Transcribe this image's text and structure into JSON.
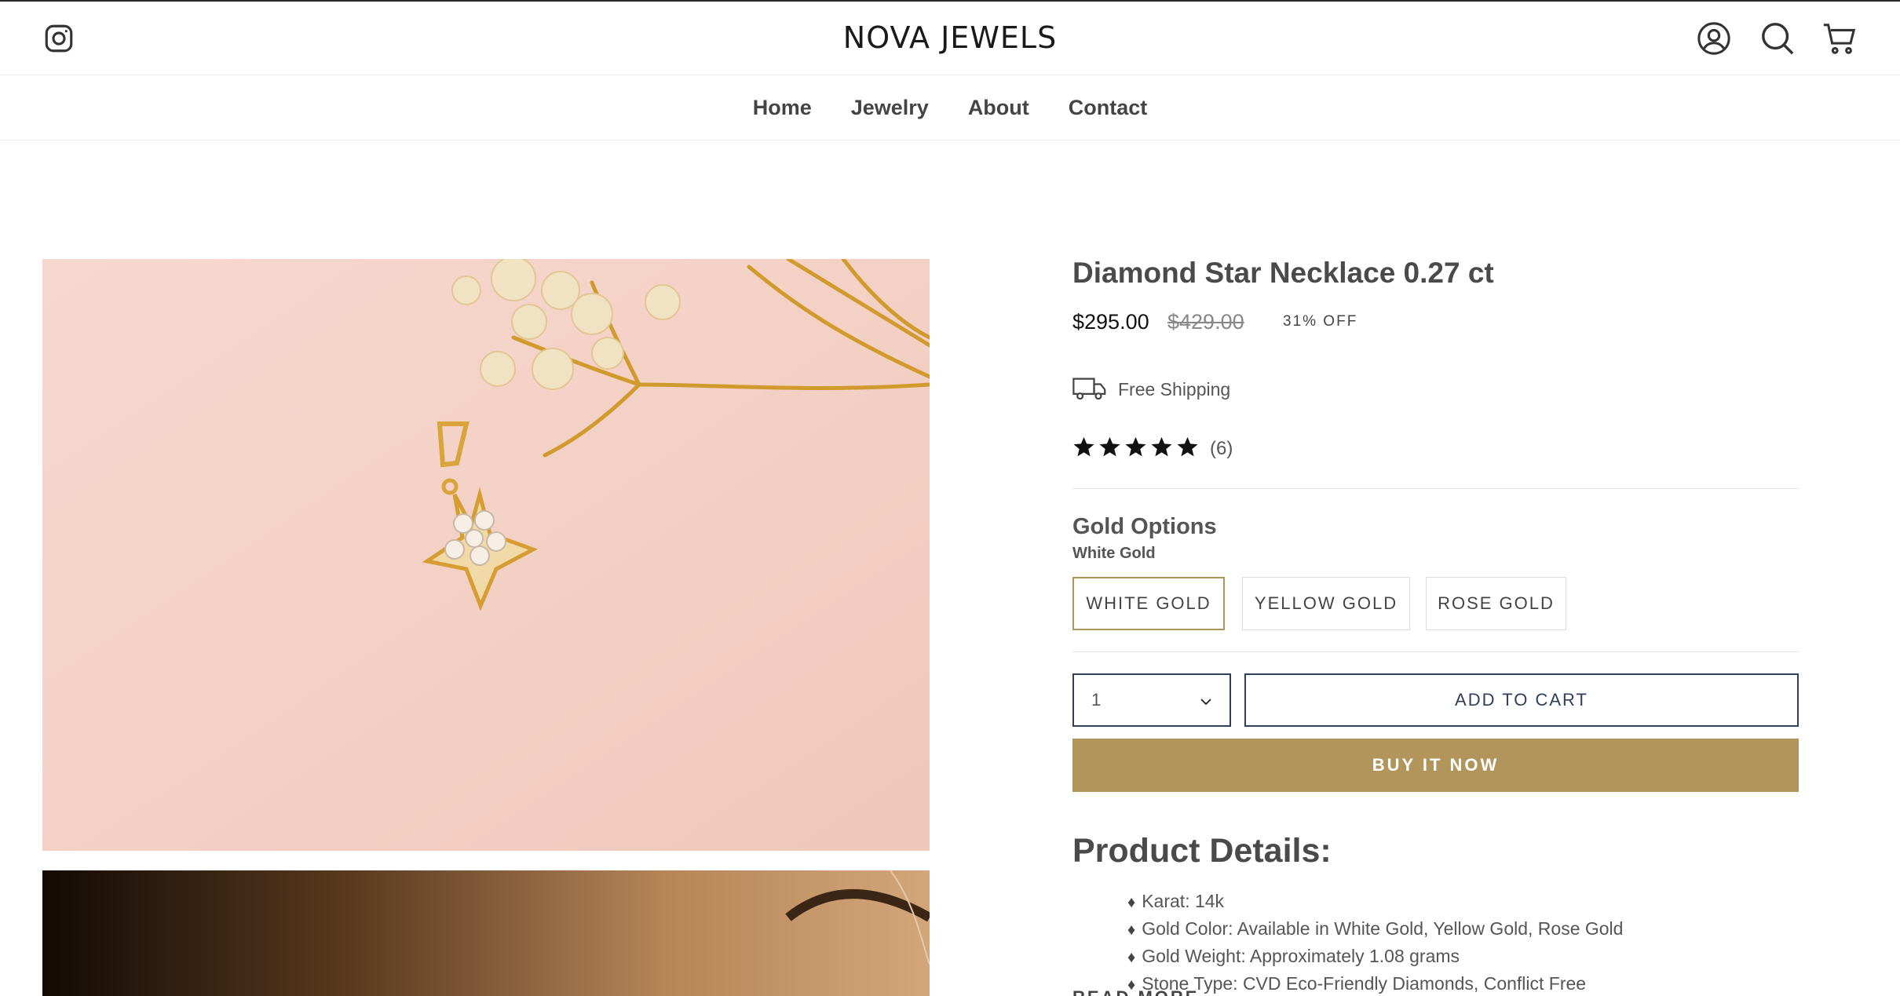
{
  "header": {
    "logo": "NOVA JEWELS",
    "icons": [
      "instagram-icon",
      "account-icon",
      "search-icon",
      "cart-icon"
    ]
  },
  "nav": {
    "items": [
      {
        "label": "Home"
      },
      {
        "label": "Jewelry"
      },
      {
        "label": "About"
      },
      {
        "label": "Contact"
      }
    ]
  },
  "product": {
    "title": "Diamond Star Necklace 0.27 ct",
    "price": "$295.00",
    "compare_price": "$429.00",
    "discount": "31% OFF",
    "shipping": "Free Shipping",
    "rating": 5,
    "reviews": "(6)",
    "option_title": "Gold Options",
    "selected_option": "White Gold",
    "options": [
      {
        "label": "WHITE GOLD",
        "selected": true
      },
      {
        "label": "YELLOW GOLD",
        "selected": false
      },
      {
        "label": "ROSE GOLD",
        "selected": false
      }
    ],
    "quantity": "1",
    "add_to_cart": "ADD TO CART",
    "buy_now": "BUY IT NOW",
    "details_heading": "Product Details:",
    "details": [
      "Karat: 14k",
      "Gold Color: Available in White Gold, Yellow Gold, Rose Gold",
      "Gold Weight: Approximately 1.08 grams",
      "Stone Type: CVD Eco-Friendly Diamonds, Conflict Free"
    ],
    "read_more": "READ MORE"
  },
  "colors": {
    "accent": "#b1955a",
    "navy": "#2f3f58",
    "selected_border": "#b39458"
  }
}
